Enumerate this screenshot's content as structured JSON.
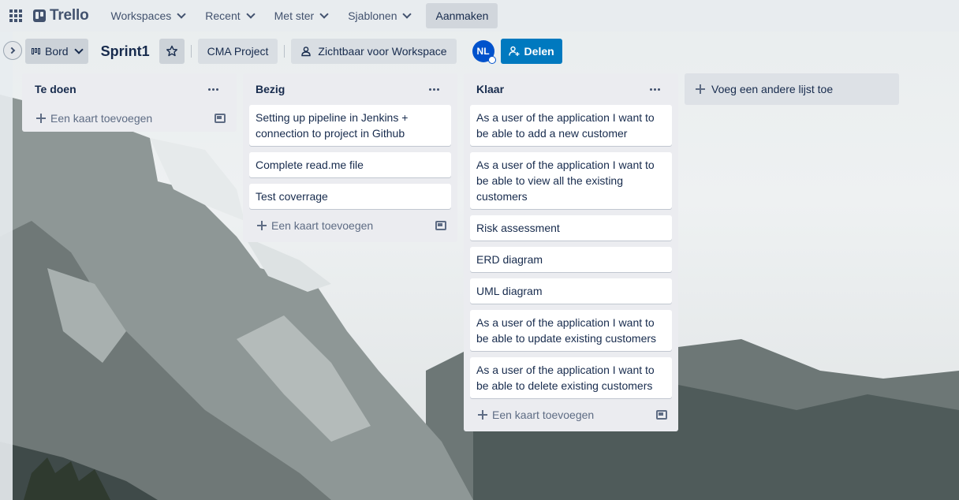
{
  "topbar": {
    "logo": "Trello",
    "nav": [
      {
        "label": "Workspaces"
      },
      {
        "label": "Recent"
      },
      {
        "label": "Met ster"
      },
      {
        "label": "Sjablonen"
      }
    ],
    "create_label": "Aanmaken"
  },
  "board": {
    "view_label": "Bord",
    "title": "Sprint1",
    "workspace_label": "CMA Project",
    "visibility_label": "Zichtbaar voor Workspace",
    "avatar_initials": "NL",
    "share_label": "Delen",
    "accent": "#0079bf"
  },
  "lists": [
    {
      "title": "Te doen",
      "cards": [],
      "add_label": "Een kaart toevoegen"
    },
    {
      "title": "Bezig",
      "cards": [
        "Setting up pipeline in Jenkins + connection to project in Github",
        "Complete read.me file",
        "Test coverrage"
      ],
      "add_label": "Een kaart toevoegen"
    },
    {
      "title": "Klaar",
      "cards": [
        "As a user of the application I want to be able to add a new customer",
        "As a user of the application I want to be able to view all the existing customers",
        "Risk assessment",
        "ERD diagram",
        "UML diagram",
        "As a user of the application I want to be able to update existing customers",
        "As a user of the application I want to be able to delete existing customers"
      ],
      "add_label": "Een kaart toevoegen"
    }
  ],
  "add_list_label": "Voeg een andere lijst toe"
}
